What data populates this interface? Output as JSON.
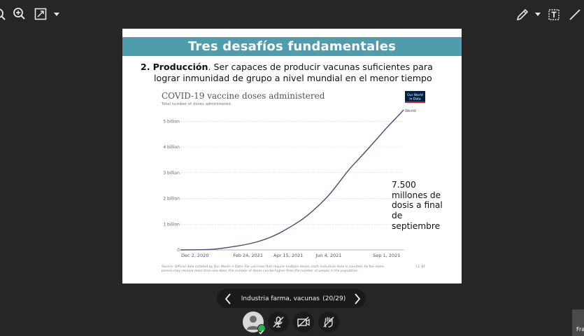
{
  "toolbar": {
    "left_icons": [
      "zoom-out-icon",
      "zoom-in-icon",
      "fullscreen-icon",
      "caret-down-icon"
    ],
    "right_icons": [
      "pen-icon",
      "caret-down-icon",
      "text-tool-icon",
      "line-tool-icon"
    ]
  },
  "slide": {
    "title": "Tres desafíos fundamentales",
    "item_number": "2.",
    "item_bold": "Producción",
    "item_text_1": ". Ser capaces de producir vacunas suficientes para",
    "item_text_2": "lograr inmunidad de grupo a nivel mundial en el menor tiempo",
    "note_lines": [
      "7.500",
      "millones de",
      "dosis a final",
      "de",
      "septiembre"
    ]
  },
  "chart_data": {
    "type": "line",
    "title": "COVID-19 vaccine doses administered",
    "subtitle": "Total number of doses administered.",
    "logo_text": [
      "Our World",
      "in Data"
    ],
    "series": [
      {
        "name": "World",
        "color": "#3d4d73",
        "x": [
          "2020-12-02",
          "2021-01-01",
          "2021-01-15",
          "2021-02-01",
          "2021-02-24",
          "2021-03-15",
          "2021-04-01",
          "2021-04-15",
          "2021-05-01",
          "2021-05-15",
          "2021-06-04",
          "2021-06-20",
          "2021-07-01",
          "2021-07-15",
          "2021-08-01",
          "2021-08-15",
          "2021-09-01",
          "2021-09-05"
        ],
        "y": [
          0,
          0.01,
          0.03,
          0.1,
          0.22,
          0.38,
          0.6,
          0.85,
          1.15,
          1.5,
          2.1,
          2.75,
          3.2,
          3.65,
          4.25,
          4.75,
          5.3,
          5.45
        ]
      }
    ],
    "x_tick_labels": [
      "Dec 2, 2020",
      "Feb 24, 2021",
      "Apr 15, 2021",
      "Jun 4, 2021",
      "Sep 1, 2021"
    ],
    "x_tick_values": [
      "2020-12-02",
      "2021-02-24",
      "2021-04-15",
      "2021-06-04",
      "2021-09-01"
    ],
    "y_tick_labels": [
      "0",
      "1 billion",
      "2 billion",
      "3 billion",
      "4 billion",
      "5 billion"
    ],
    "y_tick_values": [
      0,
      1,
      2,
      3,
      4,
      5
    ],
    "ylim": [
      0,
      5.5
    ],
    "xlim": [
      "2020-12-02",
      "2021-09-05"
    ],
    "grid": true,
    "source": "Source: Official data collated by Our World in Data. For vaccines that require multiple doses, each individual dose is counted. As the same person may receive more than one dose, the number of doses can be higher than the number of people in the population.",
    "license": "CC BY"
  },
  "nav": {
    "prev_icon": "chevron-left-icon",
    "next_icon": "chevron-right-icon",
    "presentation_title": "Industria farma, vacunas y ac...",
    "page_counter": "(20/29)"
  },
  "controls": {
    "icons": [
      "avatar-icon",
      "mic-off-icon",
      "camera-off-icon",
      "raise-hand-icon"
    ],
    "status_color": "#2cb24a"
  },
  "thumbnail": {
    "label": "Fra"
  }
}
